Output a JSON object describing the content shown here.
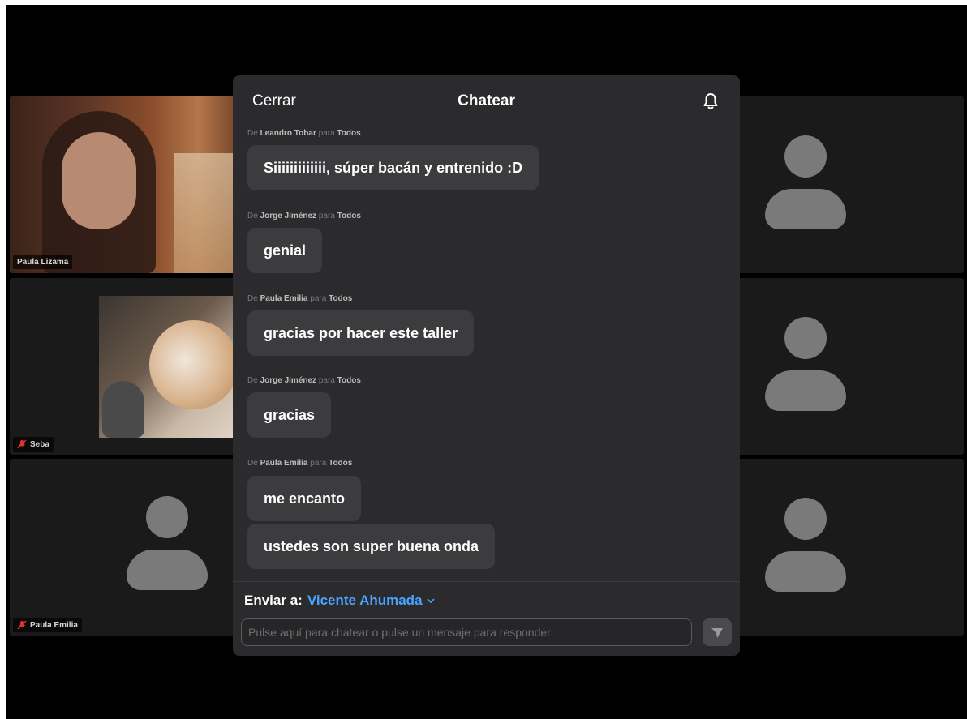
{
  "participants": {
    "paula_lizama": {
      "name": "Paula Lizama"
    },
    "seba": {
      "name": "Seba"
    },
    "paula_emilia": {
      "name": "Paula Emilia"
    }
  },
  "chat": {
    "close_label": "Cerrar",
    "title": "Chatear",
    "messages": [
      {
        "from_prefix": "De",
        "sender": "Leandro Tobar",
        "to_word": "para",
        "recipient": "Todos",
        "bubbles": [
          "Siiiiiiiiiiiii, súper bacán y entrenido :D"
        ]
      },
      {
        "from_prefix": "De",
        "sender": "Jorge Jiménez",
        "to_word": "para",
        "recipient": "Todos",
        "bubbles": [
          "genial"
        ]
      },
      {
        "from_prefix": "De",
        "sender": "Paula Emilia",
        "to_word": "para",
        "recipient": "Todos",
        "bubbles": [
          "gracias por hacer este taller"
        ]
      },
      {
        "from_prefix": "De",
        "sender": "Jorge Jiménez",
        "to_word": "para",
        "recipient": "Todos",
        "bubbles": [
          "gracias"
        ]
      },
      {
        "from_prefix": "De",
        "sender": "Paula Emilia",
        "to_word": "para",
        "recipient": "Todos",
        "bubbles": [
          "me encanto",
          "ustedes son super buena onda"
        ]
      }
    ],
    "send_to_label": "Enviar a:",
    "send_to_target": "Vicente Ahumada",
    "input_placeholder": "Pulse aquí para chatear o pulse un mensaje para responder"
  },
  "colors": {
    "accent": "#4aa3ff",
    "active_speaker": "#2fb34a",
    "mic_muted": "#e0302b"
  },
  "icons": [
    "bell-icon",
    "chevron-down-icon",
    "send-icon",
    "mic-off-icon",
    "avatar-placeholder-icon"
  ]
}
